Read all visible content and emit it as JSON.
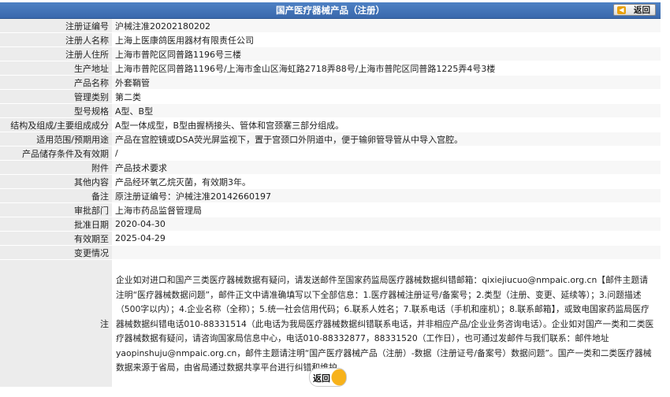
{
  "header": {
    "title": "国产医疗器械产品（注册）",
    "back_label": "返回"
  },
  "rows": [
    {
      "label": "注册证编号",
      "value": "沪械注准20202180202"
    },
    {
      "label": "注册人名称",
      "value": "上海上医康鸽医用器材有限责任公司"
    },
    {
      "label": "注册人住所",
      "value": "上海市普陀区同普路1196号三楼"
    },
    {
      "label": "生产地址",
      "value": "上海市普陀区同普路1196号/上海市金山区海虹路2718弄88号/上海市普陀区同普路1225弄4号3楼"
    },
    {
      "label": "产品名称",
      "value": "外套鞘管"
    },
    {
      "label": "管理类别",
      "value": "第二类"
    },
    {
      "label": "型号规格",
      "value": "A型、B型"
    },
    {
      "label": "结构及组成/主要组成成分",
      "value": "A型一体成型，B型由握柄接头、管体和宫颈塞三部分组成。"
    },
    {
      "label": "适用范围/预期用途",
      "value": "产品在宫腔镜或DSA荧光屏监视下，置于宫颈口外阴道中，便于输卵管导管从中导入宫腔。"
    },
    {
      "label": "产品储存条件及有效期",
      "value": "/"
    },
    {
      "label": "附件",
      "value": "产品技术要求"
    },
    {
      "label": "其他内容",
      "value": "产品经环氧乙烷灭菌，有效期3年。"
    },
    {
      "label": "备注",
      "value": "原注册证编号：沪械注准20142660197"
    },
    {
      "label": "审批部门",
      "value": "上海市药品监督管理局"
    },
    {
      "label": "批准日期",
      "value": "2020-04-30"
    },
    {
      "label": "有效期至",
      "value": "2025-04-29"
    },
    {
      "label": "变更情况",
      "value": ""
    }
  ],
  "note": {
    "label": "注",
    "text": "企业如对进口和国产三类医疗器械数据有疑问，请发送邮件至国家药监局医疗器械数据纠错邮箱：qixiejiucuo@nmpaic.org.cn【邮件主题请注明“医疗器械数据问题”，邮件正文中请准确填写以下全部信息：1.医疗器械注册证号/备案号；2.类型（注册、变更、延续等）；3.问题描述（500字以内）；4.企业名称（全称）；5.统一社会信用代码；6.联系人姓名；7.联系电话（手机和座机）；8.联系邮箱】，或致电国家药监局医疗器械数据纠错电话010-88331514（此电话为我局医疗器械数据纠错联系电话，并非相应产品/企业业务咨询电话）。企业如对国产一类和二类医疗器械数据有疑问，请咨询国家局信息中心，电话010-88332877，88331520（工作日），也可通过发邮件与我们联系：邮件地址yaopinshuju@nmpaic.org.cn，邮件主题请注明“国产医疗器械产品（注册）-数据（注册证号/备案号）数据问题”。国产一类和二类医疗器械数据来源于省局，由省局通过数据共享平台进行纠错和维护。"
  },
  "footer": {
    "back_label": "返回"
  }
}
